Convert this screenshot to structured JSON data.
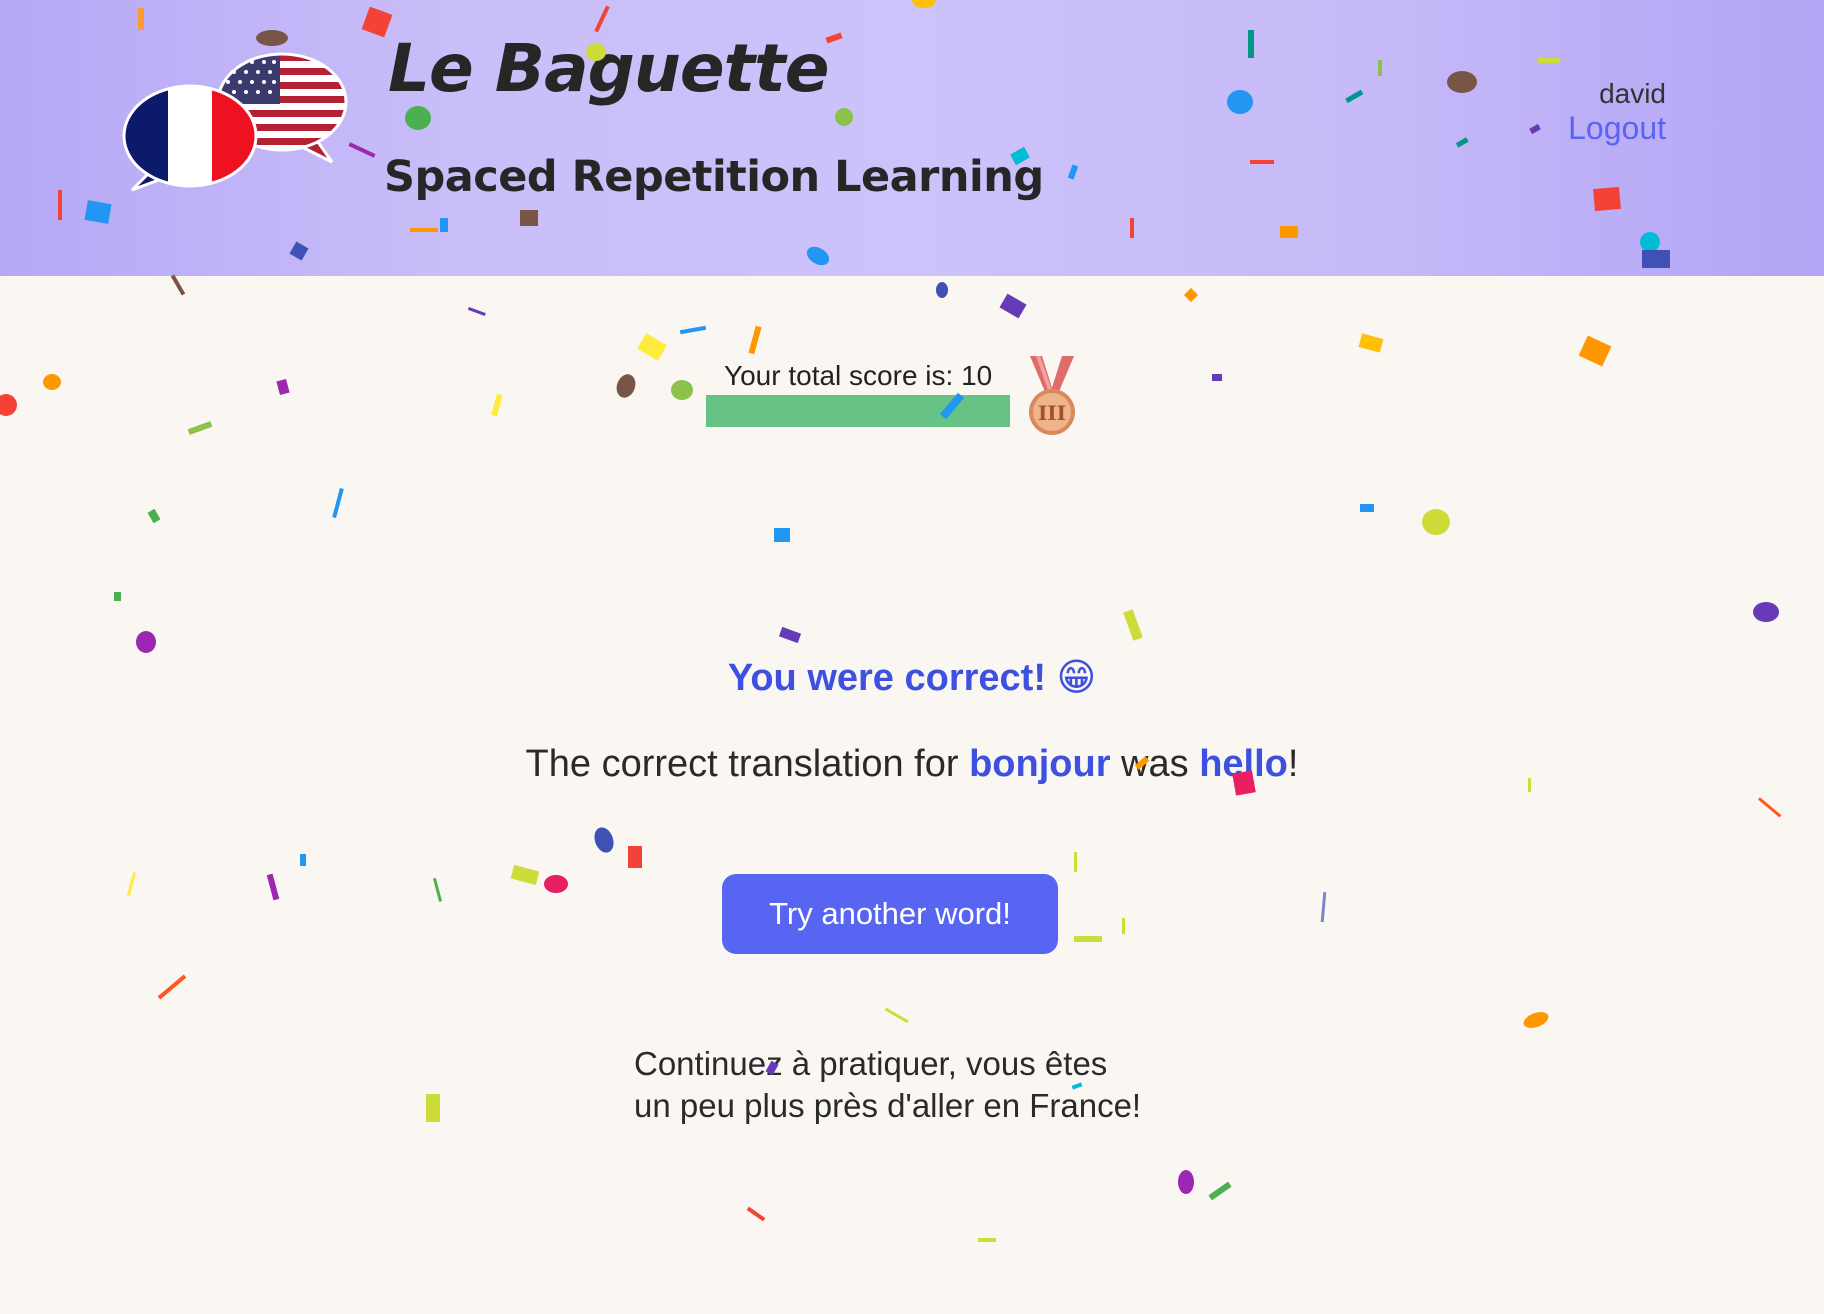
{
  "header": {
    "title": "Le Baguette",
    "subtitle": "Spaced Repetition Learning",
    "username": "david",
    "logout_label": "Logout",
    "logo_icon": "french-american-flag-speech-bubbles-icon"
  },
  "score": {
    "label": "Your total score is: 10",
    "value": 10,
    "progress_fraction": 1.0,
    "medal_icon": "bronze-medal-icon",
    "medal_numeral": "III"
  },
  "result": {
    "title": "You were correct!",
    "emoji": "😁",
    "prefix": "The correct translation for",
    "original_word": "bonjour",
    "middle": "was",
    "translation": "hello",
    "suffix": "!"
  },
  "actions": {
    "next_label": "Try another word!"
  },
  "encouragement": {
    "line1": "Continuez à pratiquer, vous êtes",
    "line2": "un peu plus près d'aller en France!"
  },
  "colors": {
    "accent": "#5865f2",
    "highlight": "#3d50e0",
    "progress": "#66c285",
    "background": "#faf7f3",
    "header_gradient": "#c9bef9"
  }
}
